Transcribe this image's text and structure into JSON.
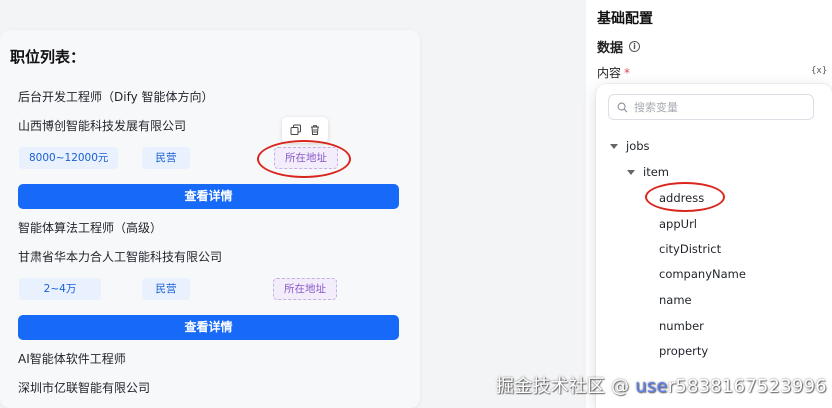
{
  "preview": {
    "list_title": "职位列表：",
    "jobs": [
      {
        "title": "后台开发工程师（Dify 智能体方向）",
        "company": "山西博创智能科技发展有限公司",
        "salary": "8000~12000元",
        "company_type": "民营",
        "address": "所在地址",
        "detail_button": "查看详情"
      },
      {
        "title": "智能体算法工程师（高级）",
        "company": "甘肃省华本力合人工智能科技有限公司",
        "salary": "2~4万",
        "company_type": "民营",
        "address": "所在地址",
        "detail_button": "查看详情"
      },
      {
        "title": "AI智能体软件工程师",
        "company": "深圳市亿联智能有限公司"
      }
    ]
  },
  "config": {
    "section_title": "基础配置",
    "data_label": "数据",
    "content_label": "内容",
    "required_mark": "*",
    "variable_icon_text": "{x}"
  },
  "variable_picker": {
    "search_placeholder": "搜索变量",
    "root": "jobs",
    "child": "item",
    "fields": [
      "address",
      "appUrl",
      "cityDistrict",
      "companyName",
      "name",
      "number",
      "property"
    ]
  },
  "watermark": {
    "text_prefix": "掘金技术社区 @ ",
    "text_mid": "use",
    "text_suffix": "r5838167523996"
  },
  "colors": {
    "primary_button": "#1769f7",
    "tag_blue_bg": "#e8f1fd",
    "tag_purple_bg": "#f3ecfb",
    "annotation_red": "#d9261c"
  }
}
